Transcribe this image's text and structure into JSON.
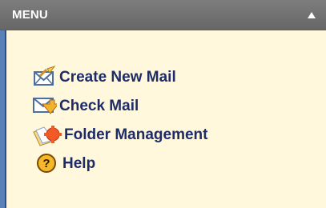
{
  "panel": {
    "title": "MENU",
    "collapse_icon": "triangle-up-icon"
  },
  "menu": {
    "items": [
      {
        "label": "Create New Mail",
        "icon": "create-mail-icon"
      },
      {
        "label": "Check Mail",
        "icon": "check-mail-icon"
      },
      {
        "label": "Folder Management",
        "icon": "folder-management-icon"
      },
      {
        "label": "Help",
        "icon": "help-icon"
      }
    ]
  },
  "colors": {
    "panel_background": "#fff8dd",
    "header_background": "#6f6f6f",
    "header_text": "#ffffff",
    "menu_text": "#1e2b67",
    "left_border": "#5b82b8"
  }
}
